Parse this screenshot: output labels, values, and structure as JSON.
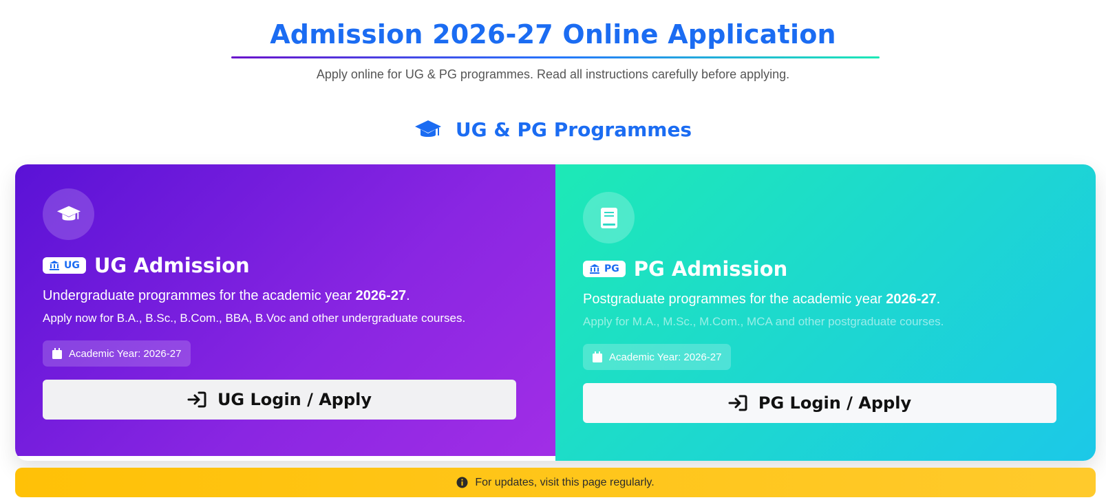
{
  "header": {
    "title": "Admission 2026-27 Online Application",
    "subtitle": "Apply online for UG & PG programmes. Read all instructions carefully before applying."
  },
  "section": {
    "heading": "UG & PG Programmes",
    "icon": "graduation-cap-icon"
  },
  "cards": {
    "ug": {
      "icon": "graduation-cap-icon",
      "badge": "UG",
      "badge_icon": "institution-icon",
      "title": "UG Admission",
      "desc_prefix": "Undergraduate programmes for the academic year ",
      "desc_year": "2026-27",
      "desc_suffix": ".",
      "sub": "Apply now for B.A., B.Sc., B.Com., BBA, B.Voc and other undergraduate courses.",
      "year_chip": "Academic Year: 2026-27",
      "button": "UG Login / Apply",
      "button_icon": "sign-in-icon"
    },
    "pg": {
      "icon": "book-icon",
      "badge": "PG",
      "badge_icon": "institution-icon",
      "title": "PG Admission",
      "desc_prefix": "Postgraduate programmes for the academic year ",
      "desc_year": "2026-27",
      "desc_suffix": ".",
      "sub": "Apply for M.A., M.Sc., M.Com., MCA and other postgraduate courses.",
      "year_chip": "Academic Year: 2026-27",
      "button": "PG Login / Apply",
      "button_icon": "sign-in-icon"
    }
  },
  "notice": {
    "icon": "info-icon",
    "text": "For updates, visit this page regularly."
  },
  "colors": {
    "primary": "#1b6cf2",
    "ug_gradient_start": "#5a12d6",
    "ug_gradient_end": "#a12ee6",
    "pg_gradient_start": "#1de9b6",
    "pg_gradient_end": "#1cc8e8",
    "notice": "#ffc107"
  }
}
